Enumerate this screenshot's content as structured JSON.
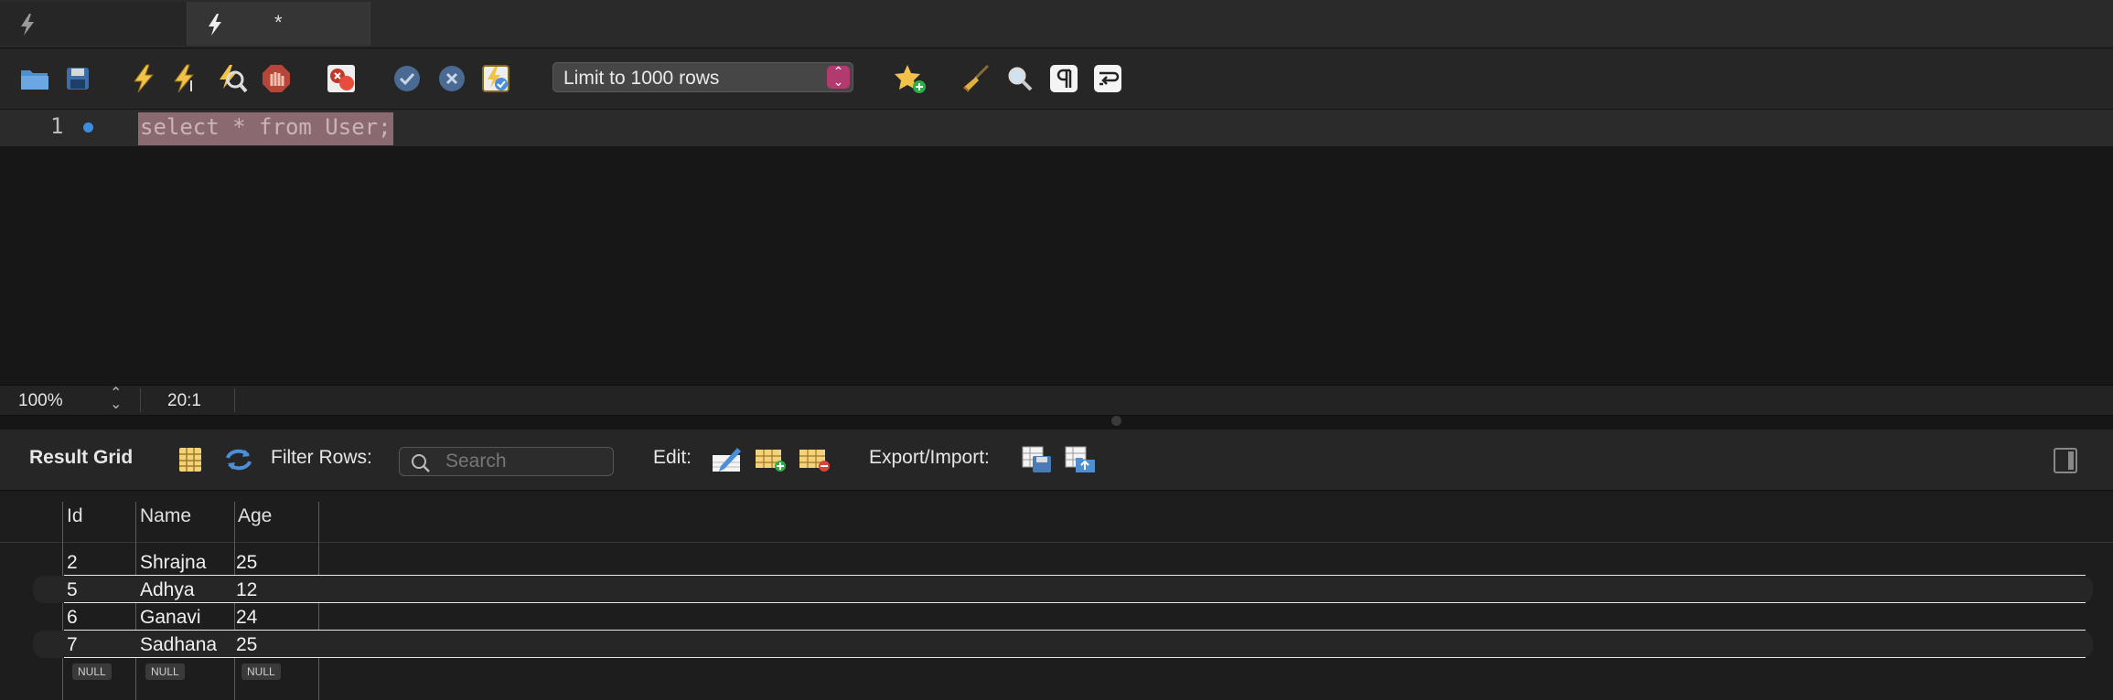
{
  "tabs": [
    {
      "label": "",
      "dirty": ""
    },
    {
      "label": "",
      "dirty": "*"
    }
  ],
  "toolbar": {
    "limit_select": "Limit to 1000 rows",
    "icons": [
      "open-folder-icon",
      "save-icon",
      "execute-icon",
      "execute-current-icon",
      "explain-icon",
      "stop-icon",
      "toggle-error-stop-icon",
      "commit-icon",
      "rollback-icon",
      "autocommit-icon",
      "bookmark-add-icon",
      "beautify-icon",
      "find-icon",
      "invisible-chars-icon",
      "word-wrap-icon"
    ]
  },
  "editor": {
    "line_number": "1",
    "sql": "select * from User;"
  },
  "statusbar": {
    "zoom": "100%",
    "cursor": "20:1"
  },
  "result_toolbar": {
    "title": "Result Grid",
    "filter_label": "Filter Rows:",
    "search_placeholder": "Search",
    "edit_label": "Edit:",
    "export_label": "Export/Import:"
  },
  "grid": {
    "columns": [
      "Id",
      "Name",
      "Age"
    ],
    "rows": [
      [
        "2",
        "Shrajna",
        "25"
      ],
      [
        "5",
        "Adhya",
        "12"
      ],
      [
        "6",
        "Ganavi",
        "24"
      ],
      [
        "7",
        "Sadhana",
        "25"
      ],
      [
        "NULL",
        "NULL",
        "NULL"
      ]
    ]
  },
  "colors": {
    "accent_stepper": "#b23a6e",
    "selection": "#8a6a70",
    "line_dot": "#3c8ce0"
  }
}
